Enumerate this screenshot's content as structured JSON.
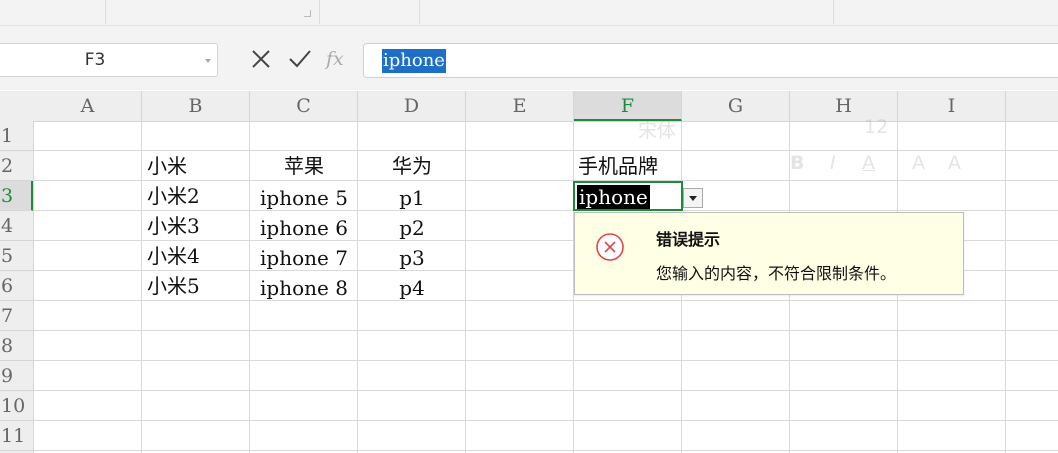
{
  "formula_bar": {
    "cell_ref": "F3",
    "cancel_icon": "x-icon",
    "confirm_icon": "check-icon",
    "fx_label": "fx",
    "content": "iphone"
  },
  "columns": [
    "A",
    "B",
    "C",
    "D",
    "E",
    "F",
    "G",
    "H",
    "I"
  ],
  "active_column": "F",
  "rows": [
    "1",
    "2",
    "3",
    "4",
    "5",
    "6",
    "7",
    "8",
    "9",
    "10",
    "11"
  ],
  "active_row": "3",
  "cells": {
    "B2": "小米",
    "C2": "苹果",
    "D2": "华为",
    "F2": "手机品牌",
    "B3": "小米2",
    "C3": "iphone 5",
    "D3": "p1",
    "B4": "小米3",
    "C4": "iphone 6",
    "D4": "p2",
    "B5": "小米4",
    "C5": "iphone 7",
    "D5": "p3",
    "B6": "小米5",
    "C6": "iphone 8",
    "D6": "p4"
  },
  "active_cell_value": "iphone",
  "dropdown_icon": "dropdown-arrow-icon",
  "ghost_toolbar": {
    "font_name": "宋体",
    "font_size": "12"
  },
  "error_tip": {
    "icon": "error-circle-icon",
    "title": "错误提示",
    "message": "您输入的内容，不符合限制条件。"
  },
  "colors": {
    "accent_green": "#1f8a3b",
    "selection_blue": "#1f6fc9",
    "error_red": "#e0464d",
    "tip_background": "#ffffe6"
  }
}
